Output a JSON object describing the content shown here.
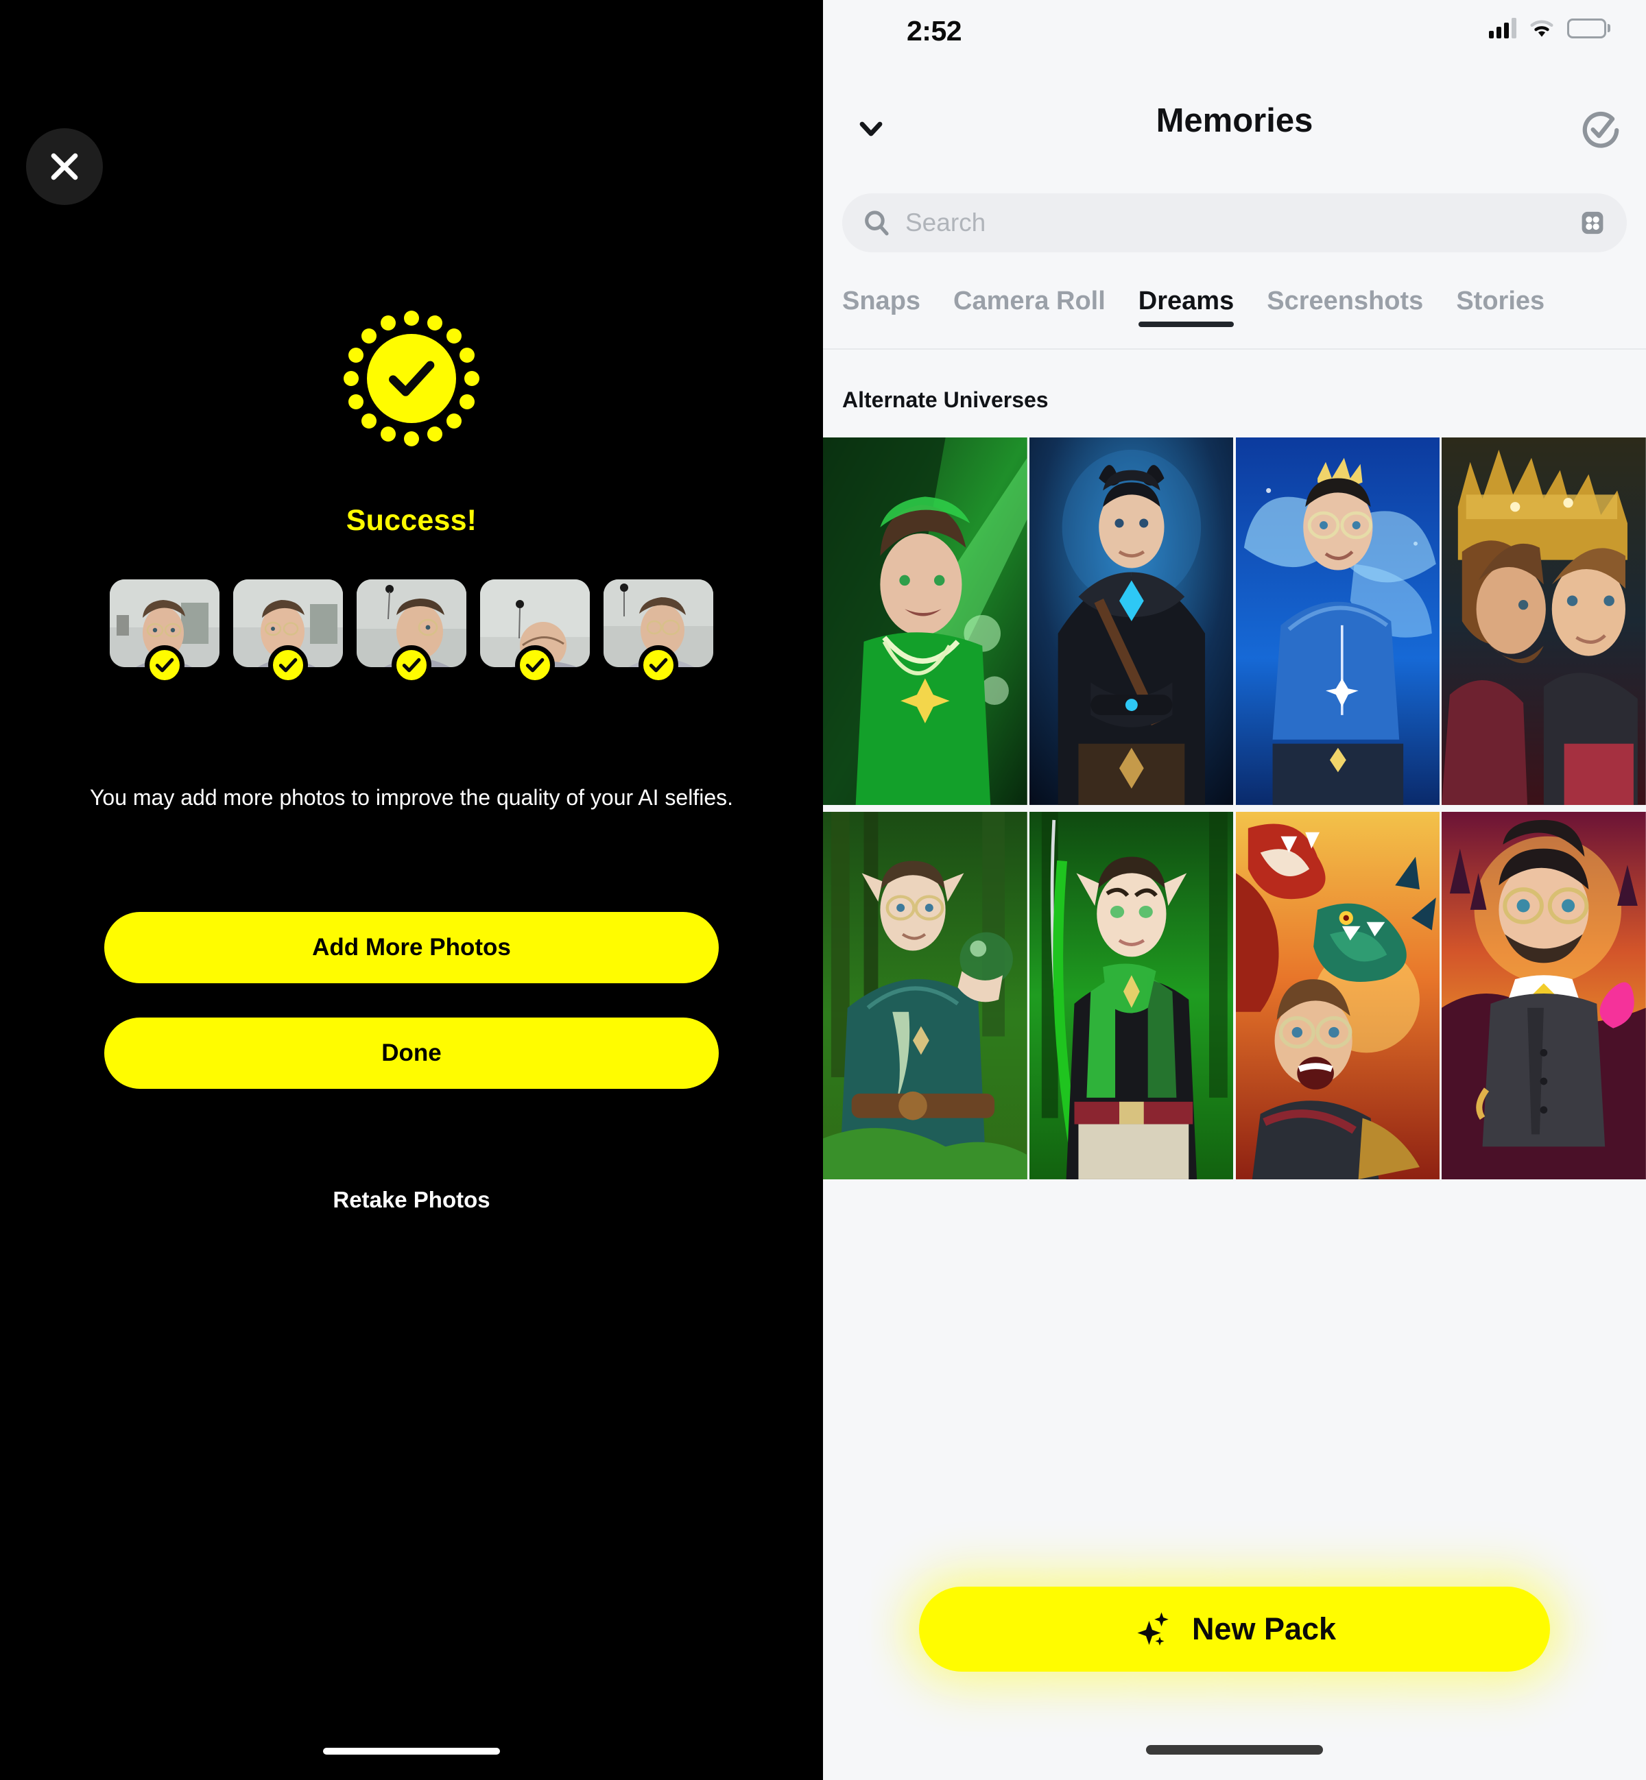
{
  "left": {
    "close_icon": "close-icon",
    "success_icon": "check-circle-burst-icon",
    "success_label": "Success!",
    "thumbnails": [
      {
        "alt": "selfie-front-facing"
      },
      {
        "alt": "selfie-three-quarter-left"
      },
      {
        "alt": "selfie-profile-right"
      },
      {
        "alt": "selfie-looking-up"
      },
      {
        "alt": "selfie-turned-away"
      }
    ],
    "thumbnail_badge_icon": "check-icon",
    "helper_text": "You may add more photos to improve the quality of your AI selfies.",
    "add_more_photos_label": "Add More Photos",
    "done_label": "Done",
    "retake_photos_label": "Retake Photos"
  },
  "right": {
    "status_bar": {
      "time": "2:52",
      "cellular_icon": "signal-bars-icon",
      "wifi_icon": "wifi-icon",
      "battery_icon": "battery-icon"
    },
    "nav": {
      "back_icon": "chevron-down-icon",
      "title": "Memories",
      "select_icon": "check-circle-outline-icon"
    },
    "search": {
      "icon": "search-icon",
      "placeholder": "Search",
      "value": "",
      "grid_view_icon": "grid-view-icon"
    },
    "tabs": [
      {
        "label": "Snaps",
        "active": false
      },
      {
        "label": "Camera Roll",
        "active": false
      },
      {
        "label": "Dreams",
        "active": true
      },
      {
        "label": "Screenshots",
        "active": false
      },
      {
        "label": "Stories",
        "active": false
      }
    ],
    "section_title": "Alternate Universes",
    "grid": [
      {
        "name": "dream-forest-prince",
        "alt": "Green forest prince with star necklace"
      },
      {
        "name": "dream-dark-warrior",
        "alt": "Armored warrior with horns and blue gem"
      },
      {
        "name": "dream-winged-fairy",
        "alt": "Winged fairy with crown in blue"
      },
      {
        "name": "dream-golden-kings",
        "alt": "Two kings with golden crowns"
      },
      {
        "name": "dream-elf-mage",
        "alt": "Elf mage holding orb in mossy forest"
      },
      {
        "name": "dream-elf-archer",
        "alt": "Elf archer with bow in green forest"
      },
      {
        "name": "dream-dragon-rider",
        "alt": "Dragon rider shouting at sunset"
      },
      {
        "name": "dream-dapper-gentleman",
        "alt": "Dapper gentleman with heart charm"
      }
    ],
    "new_pack": {
      "icon": "sparkle-icon",
      "label": "New Pack"
    }
  },
  "colors": {
    "brand_yellow": "#FFFC00",
    "panel_dark": "#000000",
    "panel_light": "#F6F7F9",
    "tab_active": "#111317",
    "tab_inactive": "#9AA0A8"
  }
}
